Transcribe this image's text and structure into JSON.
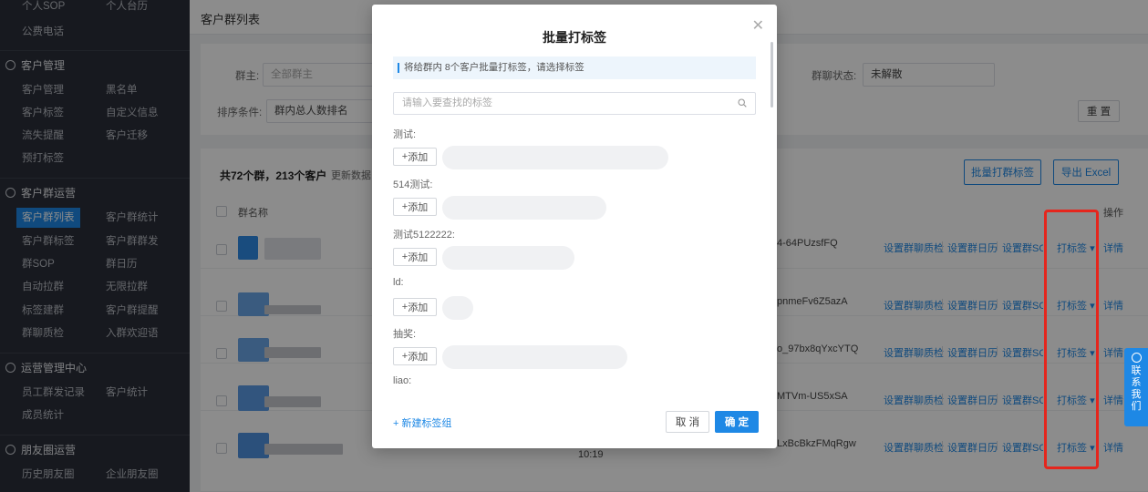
{
  "sidebar": {
    "top_cut": [
      "个人SOP",
      "个人台历"
    ],
    "public_phone": "公费电话",
    "sections": [
      {
        "title": "客户管理",
        "icon": "person-icon"
      },
      {
        "title": "客户群运营",
        "icon": "group-icon"
      },
      {
        "title": "运营管理中心",
        "icon": "dashboard-icon"
      },
      {
        "title": "朋友圈运营",
        "icon": "moments-icon"
      }
    ],
    "customer_mgmt": [
      "客户管理",
      "黑名单",
      "客户标签",
      "自定义信息",
      "流失提醒",
      "客户迁移",
      "预打标签"
    ],
    "group_ops": [
      "客户群列表",
      "客户群统计",
      "客户群标签",
      "客户群群发",
      "群SOP",
      "群日历",
      "自动拉群",
      "无限拉群",
      "标签建群",
      "客户群提醒",
      "群聊质检",
      "入群欢迎语"
    ],
    "ops_center": [
      "员工群发记录",
      "客户统计",
      "成员统计"
    ],
    "moments": [
      "历史朋友圈",
      "企业朋友圈"
    ]
  },
  "page_title": "客户群列表",
  "filters": {
    "owner_label": "群主:",
    "owner_placeholder": "全部群主",
    "status_label": "群聊状态:",
    "status_value": "未解散",
    "sort_label": "排序条件:",
    "sort_value": "群内总人数排名",
    "reset": "重 置"
  },
  "summary": {
    "count_text": "共72个群，213个客户",
    "update_text": "更新数据"
  },
  "actions": {
    "batch_tag": "批量打群标签",
    "export": "导出 Excel"
  },
  "table": {
    "col_name": "群名称",
    "col_ops": "操作",
    "row_actions": [
      "设置群聊质检",
      "设置群日历",
      "设置群SOP",
      "打标签",
      "详情"
    ],
    "rows": [
      {
        "code": "4-64PUzsfFQ"
      },
      {
        "code": "pnmeFv6Z5azA"
      },
      {
        "code": "o_97bx8qYxcYTQ"
      },
      {
        "code": "MTVm-US5xSA"
      },
      {
        "code": "LxBcBkzFMqRgw",
        "time": "10:19"
      }
    ]
  },
  "modal": {
    "title": "批量打标签",
    "tip": "将给群内 8个客户批量打标签，请选择标签",
    "search_placeholder": "请输入要查找的标签",
    "add_label": "添加",
    "groups": [
      "测试:",
      "514测试:",
      "测试5122222:",
      "ld:",
      "抽奖:",
      "liao:"
    ],
    "new_group": "+ 新建标签组",
    "cancel": "取 消",
    "ok": "确 定"
  },
  "contact": "联系我们"
}
